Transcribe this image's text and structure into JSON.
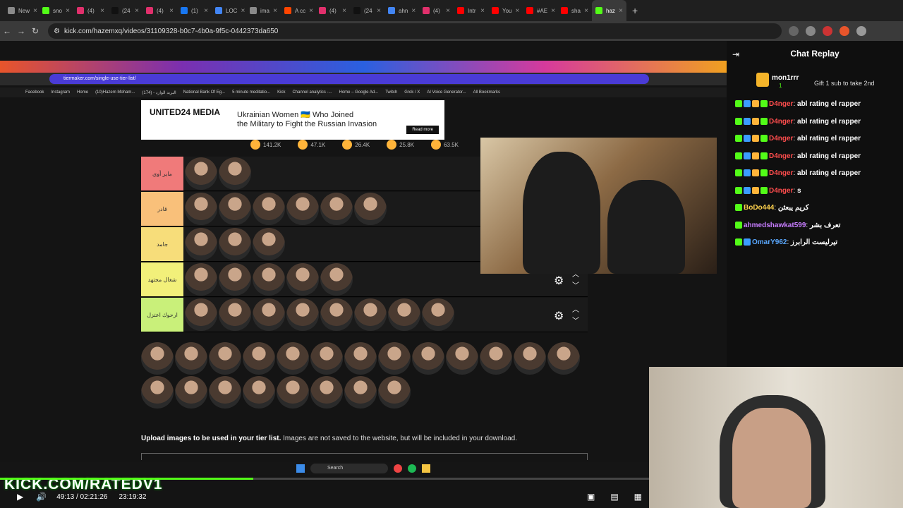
{
  "browser": {
    "tabs": [
      {
        "label": "New",
        "color": "#8a8a8a"
      },
      {
        "label": "sno",
        "color": "#53fc18"
      },
      {
        "label": "(4)",
        "color": "#e1306c"
      },
      {
        "label": "(24",
        "color": "#111111"
      },
      {
        "label": "(4)",
        "color": "#e1306c"
      },
      {
        "label": "(1)",
        "color": "#1877f2"
      },
      {
        "label": "LOC",
        "color": "#4285f4"
      },
      {
        "label": "ima",
        "color": "#8a8a8a"
      },
      {
        "label": "A cc",
        "color": "#ff4500"
      },
      {
        "label": "(4)",
        "color": "#e1306c"
      },
      {
        "label": "(24",
        "color": "#111111"
      },
      {
        "label": "ahn",
        "color": "#4285f4"
      },
      {
        "label": "(4)",
        "color": "#e1306c"
      },
      {
        "label": "Intr",
        "color": "#ff0000"
      },
      {
        "label": "You",
        "color": "#ff0000"
      },
      {
        "label": "#AE",
        "color": "#ff0000"
      },
      {
        "label": "sha",
        "color": "#ff0000"
      },
      {
        "label": "haz",
        "color": "#53fc18",
        "active": true
      }
    ],
    "url": "kick.com/hazemxq/videos/31109328-b0c7-4b0a-9f5c-0442373da650"
  },
  "inner_browser": {
    "url": "tiermaker.com/single-use-tier-list/",
    "bookmarks": [
      "Facebook",
      "Instagram",
      "Home",
      "(10)Hazem Moham...",
      "(174) - البريد الوارد",
      "National Bank Of Eg...",
      "5 minute meditatio...",
      "Kick",
      "Channel analytics -...",
      "Home – Google Ad...",
      "Twitch",
      "Grok / X",
      "AI Voice Generator...",
      "All Bookmarks"
    ],
    "search_label": "Search"
  },
  "ad": {
    "brand": "UNITED24 MEDIA",
    "headline_1": "Ukrainian Women 🇺🇦 Who Joined",
    "headline_2": "the Military to Fight the Russian Invasion",
    "cta": "Read more"
  },
  "reactions": [
    "141.2K",
    "47.1K",
    "26.4K",
    "25.8K",
    "63.5K"
  ],
  "tiers": [
    {
      "label": "ماير أوي",
      "color": "#f07a7a",
      "count": 2
    },
    {
      "label": "قادر",
      "color": "#f9c07a",
      "count": 6
    },
    {
      "label": "جامد",
      "color": "#f7dd7a",
      "count": 3
    },
    {
      "label": "شغال مجتهد",
      "color": "#f2f07a",
      "count": 5
    },
    {
      "label": "ارحوك اعتزل",
      "color": "#c9f07a",
      "count": 8
    }
  ],
  "pool_count": 21,
  "upload": {
    "bold": "Upload images to be used in your tier list.",
    "normal": " Images are not saved to the website, but will be included in your download."
  },
  "player": {
    "branding": "KICK.COM/RATEDV1",
    "time": "49:13 / 02:21:26",
    "clock": "23:19:32",
    "progress": 0.39
  },
  "chat": {
    "title": "Chat Replay",
    "gift": {
      "user": "mon1rrr",
      "count": "1",
      "text": "Gift 1 sub to take 2nd"
    },
    "messages": [
      {
        "user": "D4nger",
        "color": "#ff4d4d",
        "text": "abl rating el rapper",
        "badges": 4
      },
      {
        "user": "D4nger",
        "color": "#ff4d4d",
        "text": "abl rating el rapper",
        "badges": 4
      },
      {
        "user": "D4nger",
        "color": "#ff4d4d",
        "text": "abl rating el rapper",
        "badges": 4
      },
      {
        "user": "D4nger",
        "color": "#ff4d4d",
        "text": "abl rating el rapper",
        "badges": 4
      },
      {
        "user": "D4nger",
        "color": "#ff4d4d",
        "text": "abl rating el rapper",
        "badges": 4
      },
      {
        "user": "D4nger",
        "color": "#ff4d4d",
        "text": "s",
        "badges": 4
      },
      {
        "user": "BoDo444",
        "color": "#ffd24d",
        "text": "كريم يبعثن",
        "badges": 1
      },
      {
        "user": "ahmedshawkat599",
        "color": "#c77dff",
        "text": "تعرف بشر",
        "badges": 1
      },
      {
        "user": "OmarY962",
        "color": "#5aa8ff",
        "text": "تيرليست الرابرز",
        "badges": 2
      }
    ]
  }
}
